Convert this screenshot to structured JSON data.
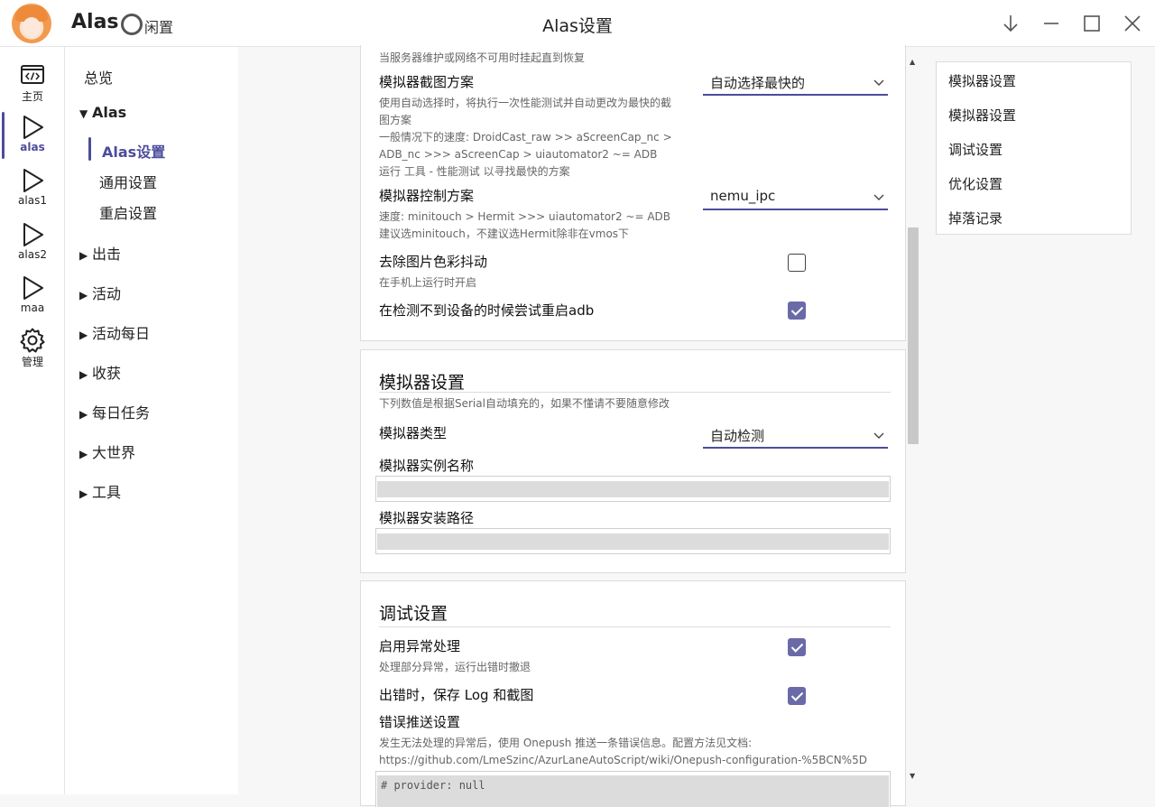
{
  "header": {
    "app_name": "Alas",
    "status": "闲置",
    "page_title": "Alas设置"
  },
  "rail": {
    "items": [
      {
        "label": "主页",
        "icon": "code-window-icon"
      },
      {
        "label": "alas",
        "icon": "play-icon",
        "active": true
      },
      {
        "label": "alas1",
        "icon": "play-icon"
      },
      {
        "label": "alas2",
        "icon": "play-icon"
      },
      {
        "label": "maa",
        "icon": "play-icon"
      },
      {
        "label": "管理",
        "icon": "gear-icon"
      }
    ]
  },
  "nav": {
    "overview": "总览",
    "group_alas": "Alas",
    "alas_settings": "Alas设置",
    "general_settings": "通用设置",
    "restart_settings": "重启设置",
    "sortie": "出击",
    "event": "活动",
    "event_daily": "活动每日",
    "harvest": "收获",
    "daily_tasks": "每日任务",
    "opsi": "大世界",
    "tools": "工具"
  },
  "emulator_card": {
    "top_cut_text": "当服务器维护或网络不可用时挂起直到恢复",
    "screenshot_method": {
      "title": "模拟器截图方案",
      "help": [
        "使用自动选择时，将执行一次性能测试并自动更改为最快的截",
        "图方案",
        "一般情况下的速度: DroidCast_raw >> aScreenCap_nc >",
        "ADB_nc >>> aScreenCap > uiautomator2 ~= ADB",
        "运行 工具 - 性能测试 以寻找最快的方案"
      ],
      "value": "自动选择最快的"
    },
    "control_method": {
      "title": "模拟器控制方案",
      "help": [
        "速度: minitouch > Hermit >>> uiautomator2 ~= ADB",
        "建议选minitouch，不建议选Hermit除非在vmos下"
      ],
      "value": "nemu_ipc"
    },
    "remove_dither": {
      "title": "去除图片色彩抖动",
      "help": "在手机上运行时开启",
      "checked": false
    },
    "restart_adb": {
      "title": "在检测不到设备的时候尝试重启adb",
      "checked": true
    }
  },
  "emulator_settings_card": {
    "title": "模拟器设置",
    "subtitle": "下列数值是根据Serial自动填充的，如果不懂请不要随意修改",
    "emulator_type": {
      "title": "模拟器类型",
      "value": "自动检测"
    },
    "instance_name": {
      "title": "模拟器实例名称",
      "value": ""
    },
    "install_path": {
      "title": "模拟器安装路径",
      "value": ""
    }
  },
  "debug_card": {
    "title": "调试设置",
    "handle_error": {
      "title": "启用异常处理",
      "help": "处理部分异常，运行出错时撤退",
      "checked": true
    },
    "save_error": {
      "title": "出错时，保存 Log 和截图",
      "checked": true
    },
    "onepush": {
      "title": "错误推送设置",
      "help": [
        "发生无法处理的异常后，使用 Onepush 推送一条错误信息。配置方法见文档:",
        "https://github.com/LmeSzinc/AzurLaneAutoScript/wiki/Onepush-configuration-%5BCN%5D"
      ],
      "code_preview": "# provider: null"
    }
  },
  "toc": {
    "items": [
      "模拟器设置",
      "模拟器设置",
      "调试设置",
      "优化设置",
      "掉落记录"
    ]
  },
  "colors": {
    "accent": "#4c4c9c",
    "checkbox_checked": "#6a6aa8"
  }
}
